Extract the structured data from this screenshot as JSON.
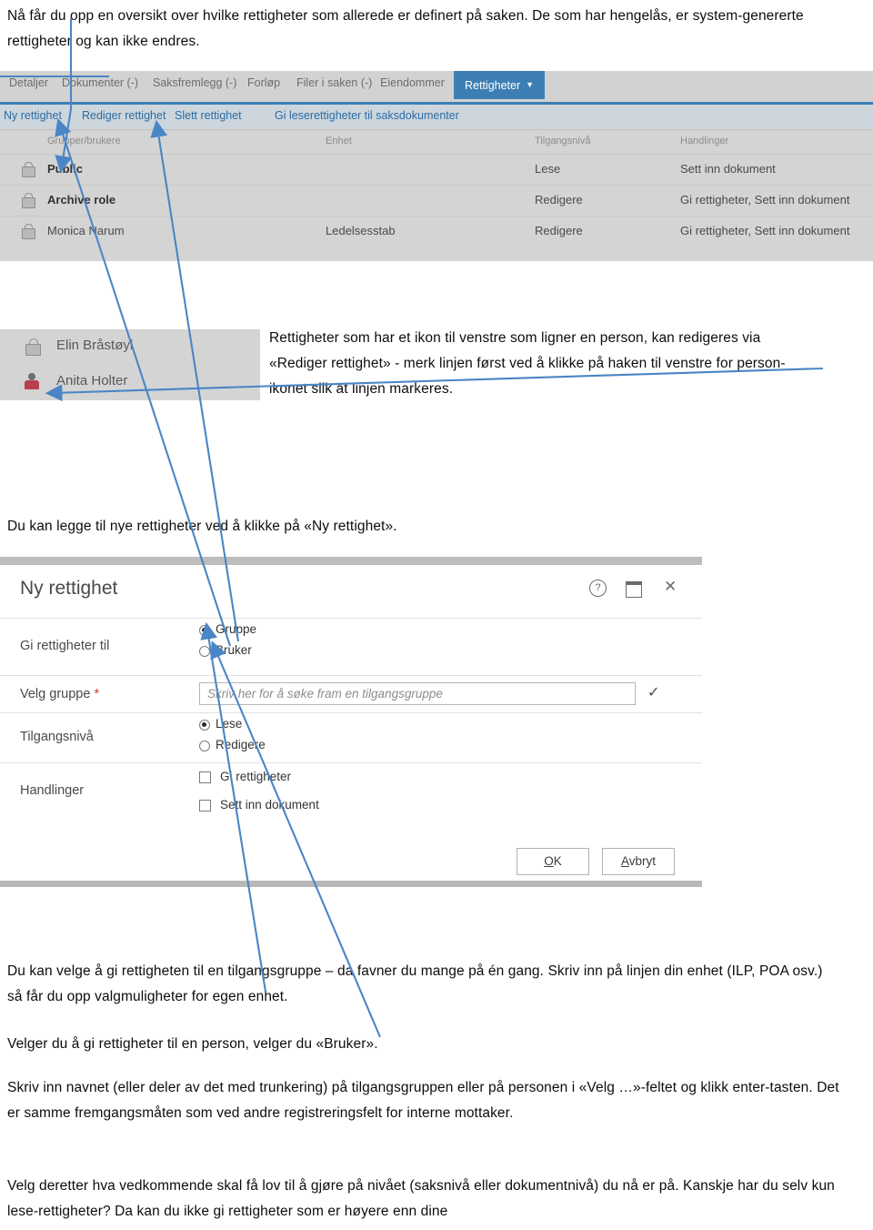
{
  "doc": {
    "intro": "Nå får du opp en oversikt over hvilke rettigheter som allerede er definert på saken. De som har hengelås, er system-genererte rettigheter og kan ikke endres.",
    "para_person_icon": "Rettigheter som har et ikon til venstre som ligner en person, kan redigeres via «Rediger rettighet» - merk linjen først ved å klikke på haken til venstre for person-ikonet slik at linjen markeres.",
    "para_new_right": "Du kan legge til nye rettigheter ved å klikke på «Ny rettighet».",
    "para_group": "Du kan velge å gi rettigheten til en tilgangsgruppe – da favner du mange på én gang. Skriv inn på linjen din enhet (ILP, POA osv.) så får du opp valgmuligheter for egen enhet.",
    "para_user": "Velger du å gi rettigheter til en person, velger du «Bruker».",
    "para_typename": "Skriv inn navnet (eller deler av det med trunkering) på tilgangsgruppen eller på personen i «Velg …»-feltet og klikk enter-tasten. Det er samme fremgangsmåten som ved andre registreringsfelt for interne mottaker.",
    "para_level": "Velg deretter hva vedkommende skal få lov til å gjøre på nivået (saksnivå eller dokumentnivå) du nå er på. Kanskje har du selv kun lese-rettigheter? Da kan du ikke gi rettigheter som er høyere enn dine"
  },
  "colors": {
    "accent_blue": "#3d7fb5",
    "link_blue": "#2b6ca3",
    "arrow_blue": "#4a86c5",
    "screenshot_gray": "#d4d4d4",
    "toolbar_bg": "#cdd6dd",
    "required_red": "#d03a2c"
  },
  "screenshot_rights": {
    "tabs": [
      {
        "label": "Detaljer",
        "active": false
      },
      {
        "label": "Dokumenter (-)",
        "active": false
      },
      {
        "label": "Saksfremlegg (-)",
        "active": false
      },
      {
        "label": "Forløp",
        "active": false
      },
      {
        "label": "Filer i saken (-)",
        "active": false
      },
      {
        "label": "Eiendommer",
        "active": false
      },
      {
        "label": "Rettigheter",
        "active": true
      }
    ],
    "toolbar": [
      {
        "label": "Ny rettighet"
      },
      {
        "label": "Rediger rettighet"
      },
      {
        "label": "Slett rettighet"
      },
      {
        "label": "Gi leserettigheter til saksdokumenter"
      }
    ],
    "columns": [
      "Grupper/brukere",
      "Enhet",
      "Tilgangsnivå",
      "Handlinger"
    ],
    "rows": [
      {
        "icon": "lock-icon",
        "name": "Public",
        "bold": true,
        "enhet": "",
        "tilgangsniva": "Lese",
        "handlinger": "Sett inn dokument"
      },
      {
        "icon": "lock-icon",
        "name": "Archive role",
        "bold": true,
        "enhet": "",
        "tilgangsniva": "Redigere",
        "handlinger": "Gi rettigheter, Sett inn dokument"
      },
      {
        "icon": "lock-icon",
        "name": "Monica Narum",
        "bold": false,
        "enhet": "Ledelsesstab",
        "tilgangsniva": "Redigere",
        "handlinger": "Gi rettigheter, Sett inn dokument"
      }
    ]
  },
  "screenshot_persons": {
    "rows": [
      {
        "icon": "lock-icon",
        "name": "Elin Bråstøyl"
      },
      {
        "icon": "person-icon",
        "name": "Anita Holter"
      }
    ]
  },
  "dialog": {
    "title": "Ny rettighet",
    "window_buttons": [
      {
        "name": "help-icon",
        "glyph": "?"
      },
      {
        "name": "maximize-icon",
        "glyph": "▭"
      },
      {
        "name": "close-icon",
        "glyph": "✕"
      }
    ],
    "fields": {
      "gi_rettigheter_til": {
        "label": "Gi rettigheter til",
        "options": [
          {
            "label": "Gruppe",
            "selected": true
          },
          {
            "label": "Bruker",
            "selected": false
          }
        ]
      },
      "velg_gruppe": {
        "label": "Velg gruppe",
        "required_marker": "*",
        "placeholder": "Skriv her for å søke fram en tilgangsgruppe",
        "value": "",
        "confirm_icon": "✓"
      },
      "tilgangsniva": {
        "label": "Tilgangsnivå",
        "options": [
          {
            "label": "Lese",
            "selected": true
          },
          {
            "label": "Redigere",
            "selected": false
          }
        ]
      },
      "handlinger": {
        "label": "Handlinger",
        "options": [
          {
            "label": "Gi rettigheter",
            "checked": false
          },
          {
            "label": "Sett inn dokument",
            "checked": false
          }
        ]
      }
    },
    "buttons": {
      "ok": {
        "first": "O",
        "rest": "K"
      },
      "cancel": {
        "first": "A",
        "rest": "vbryt"
      }
    }
  }
}
